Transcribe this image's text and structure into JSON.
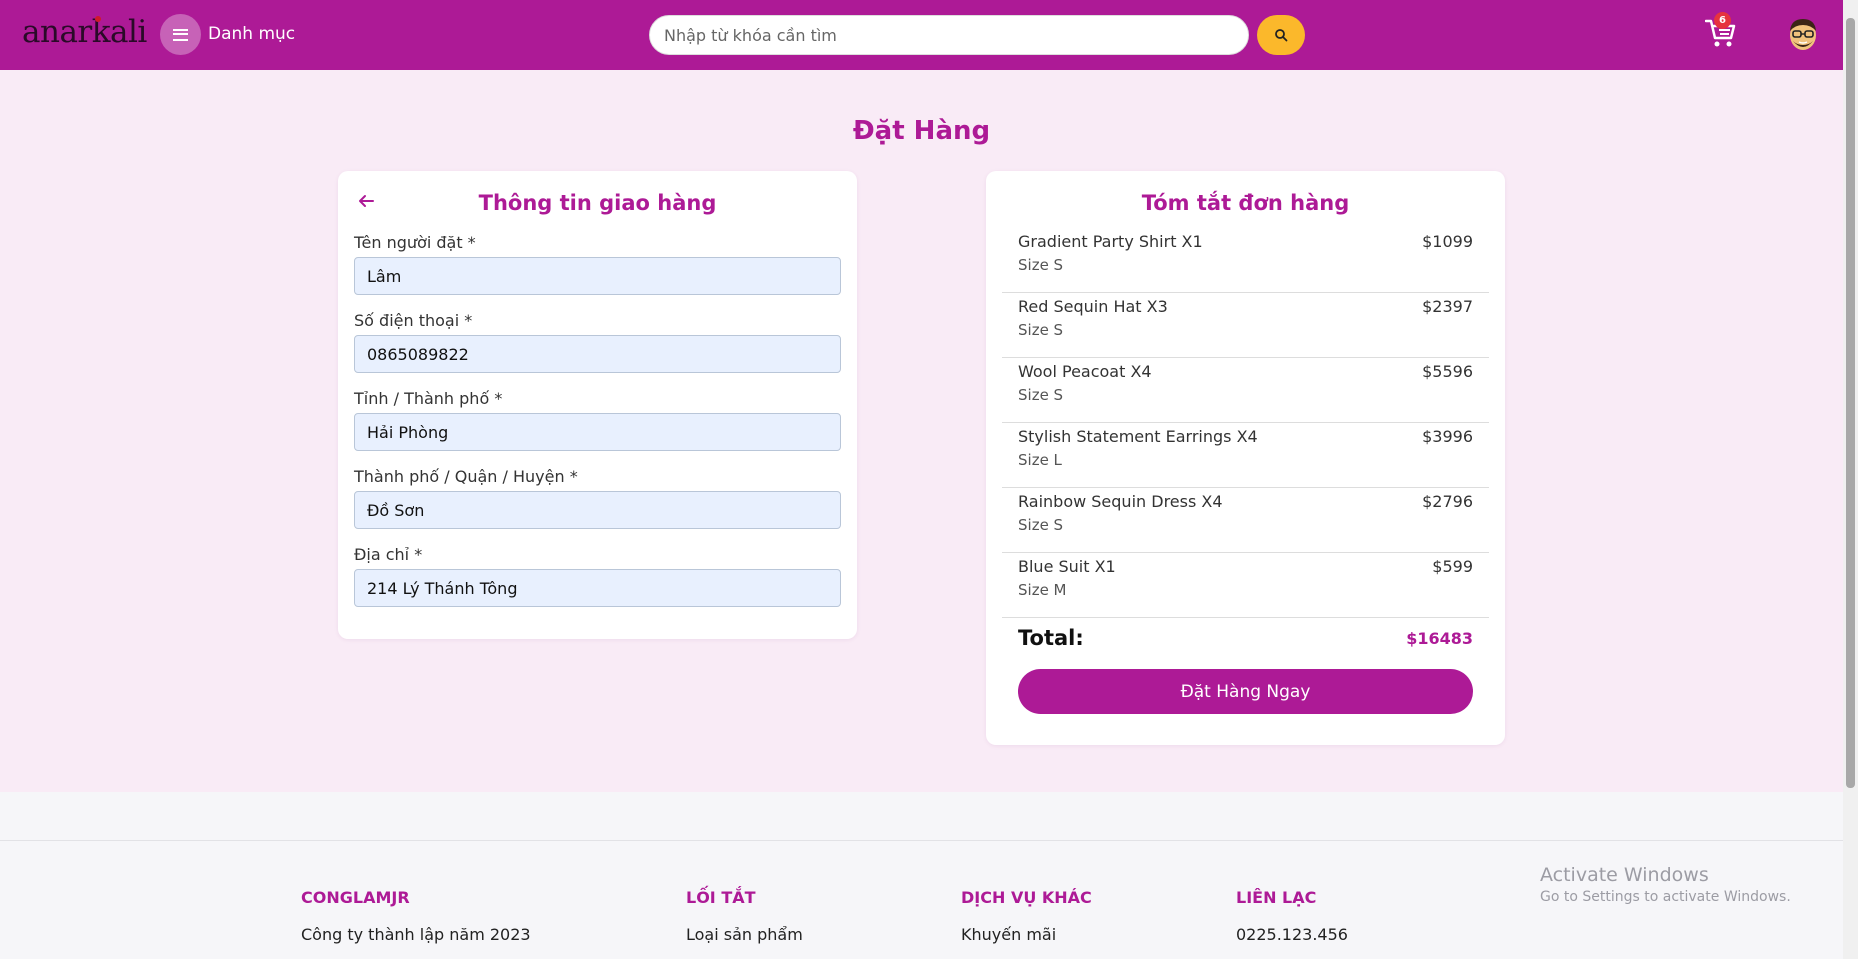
{
  "header": {
    "logo": "anarkali",
    "menu_label": "Danh mục",
    "search_placeholder": "Nhập từ khóa cần tìm",
    "cart_count": "6"
  },
  "page_title": "Đặt Hàng",
  "shipping": {
    "title": "Thông tin giao hàng",
    "fields": [
      {
        "label": "Tên người đặt *",
        "value": "Lâm"
      },
      {
        "label": "Số điện thoại *",
        "value": "0865089822"
      },
      {
        "label": "Tỉnh / Thành phố *",
        "value": "Hải Phòng"
      },
      {
        "label": "Thành phố / Quận / Huyện *",
        "value": "Đồ Sơn"
      },
      {
        "label": "Địa chỉ *",
        "value": "214 Lý Thánh Tông"
      }
    ]
  },
  "summary": {
    "title": "Tóm tắt đơn hàng",
    "items": [
      {
        "name": "Gradient Party Shirt X1",
        "size": "Size S",
        "price": "$1099"
      },
      {
        "name": "Red Sequin Hat X3",
        "size": "Size S",
        "price": "$2397"
      },
      {
        "name": "Wool Peacoat X4",
        "size": "Size S",
        "price": "$5596"
      },
      {
        "name": "Stylish Statement Earrings X4",
        "size": "Size L",
        "price": "$3996"
      },
      {
        "name": "Rainbow Sequin Dress X4",
        "size": "Size S",
        "price": "$2796"
      },
      {
        "name": "Blue Suit X1",
        "size": "Size M",
        "price": "$599"
      }
    ],
    "total_label": "Total:",
    "total_value": "$16483",
    "order_button": "Đặt Hàng Ngay"
  },
  "footer": {
    "columns": [
      {
        "heading": "CONGLAMJR",
        "text": "Công ty thành lập năm 2023"
      },
      {
        "heading": "LỐI TẮT",
        "text": "Loại sản phẩm"
      },
      {
        "heading": "DỊCH VỤ KHÁC",
        "text": "Khuyến mãi"
      },
      {
        "heading": "LIÊN LẠC",
        "text": "0225.123.456"
      }
    ]
  },
  "watermark": {
    "line1": "Activate Windows",
    "line2": "Go to Settings to activate Windows."
  },
  "colors": {
    "brand": "#ad1a96",
    "accent": "#fbb82b",
    "background": "#f9ebf6",
    "badge": "#e6333e"
  },
  "icons": [
    "menu-icon",
    "search-icon",
    "cart-icon",
    "avatar-icon",
    "back-arrow-icon"
  ]
}
